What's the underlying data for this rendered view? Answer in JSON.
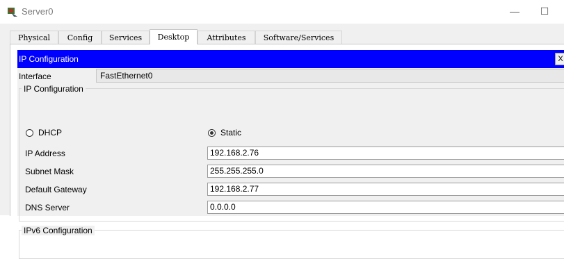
{
  "window": {
    "title": "Server0",
    "minimize_glyph": "—",
    "maximize_glyph": "☐"
  },
  "tabs": [
    {
      "label": "Physical",
      "active": false
    },
    {
      "label": "Config",
      "active": false
    },
    {
      "label": "Services",
      "active": false
    },
    {
      "label": "Desktop",
      "active": true
    },
    {
      "label": "Attributes",
      "active": false
    },
    {
      "label": "Software/Services",
      "active": false
    }
  ],
  "ip_config": {
    "header_title": "IP Configuration",
    "close_glyph": "X",
    "interface_label": "Interface",
    "interface_value": "FastEthernet0",
    "group_title": "IP Configuration",
    "dhcp_label": "DHCP",
    "static_label": "Static",
    "mode_selected": "Static",
    "fields": [
      {
        "label": "IP Address",
        "value": "192.168.2.76"
      },
      {
        "label": "Subnet Mask",
        "value": "255.255.255.0"
      },
      {
        "label": "Default Gateway",
        "value": "192.168.2.77"
      },
      {
        "label": "DNS Server",
        "value": "0.0.0.0"
      }
    ],
    "ipv6_group_title": "IPv6 Configuration"
  },
  "colors": {
    "header_bar": "#0000ff",
    "panel_bg": "#f0f0f0"
  },
  "icons": {
    "app_icon": "packet-tracer-server-icon"
  }
}
